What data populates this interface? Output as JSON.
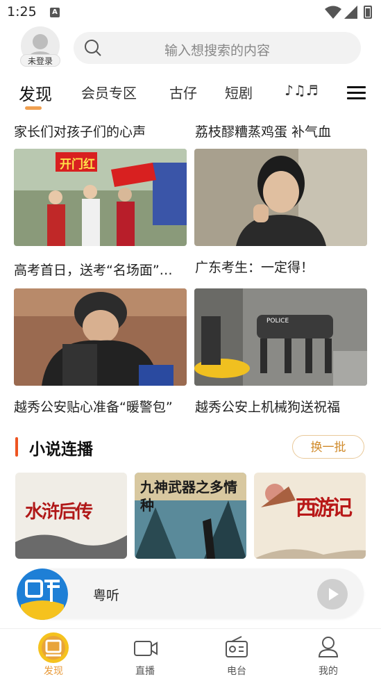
{
  "status_bar": {
    "time": "1:25",
    "notification_letter": "A"
  },
  "header": {
    "login_label": "未登录",
    "search_placeholder": "输入想搜索的内容"
  },
  "tabs": [
    {
      "label": "发现",
      "active": true
    },
    {
      "label": "会员专区"
    },
    {
      "label": "古仔"
    },
    {
      "label": "短剧"
    },
    {
      "label": "♪♫♬"
    }
  ],
  "feed": {
    "top_captions": [
      "家长们对孩子们的心声",
      "荔枝醪糟蒸鸡蛋 补气血"
    ],
    "cards": [
      {
        "caption": "高考首日，送考“名场面”…",
        "overlay": "开门红"
      },
      {
        "caption": "广东考生：一定得！"
      },
      {
        "caption": "越秀公安贴心准备“暖警包”"
      },
      {
        "caption": "越秀公安上机械狗送祝福",
        "overlay": "POLICE"
      }
    ]
  },
  "novel_section": {
    "title": "小说连播",
    "refresh_label": "换一批",
    "covers": [
      {
        "text": "水浒后传"
      },
      {
        "text": "九神武器之多情种"
      },
      {
        "text": "西游记"
      }
    ]
  },
  "player": {
    "title": "粤听"
  },
  "bottom_nav": [
    {
      "label": "发现",
      "active": true
    },
    {
      "label": "直播"
    },
    {
      "label": "电台"
    },
    {
      "label": "我的"
    }
  ],
  "colors": {
    "accent": "#f0a050",
    "section_bar": "#ee5522",
    "refresh_text": "#d08a2a"
  }
}
